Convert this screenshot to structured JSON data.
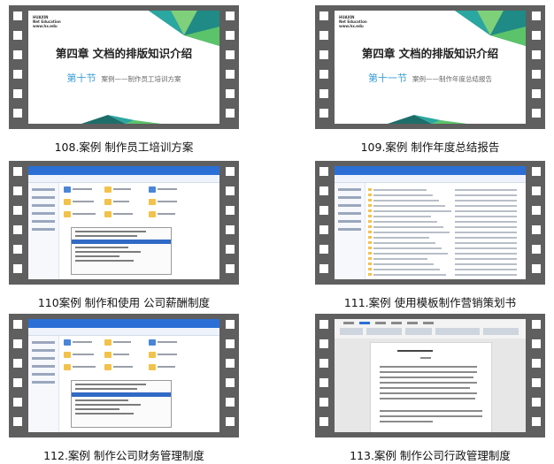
{
  "items": [
    {
      "caption": "108.案例 制作员工培训方案",
      "kind": "slide",
      "slide": {
        "logo": [
          "HUAXIN",
          "Net Education",
          "www.hx.edu"
        ],
        "title": "第四章  文档的排版知识介绍",
        "section": "第十节",
        "subtitle": "案例——制作员工培训方案"
      }
    },
    {
      "caption": "109.案例 制作年度总结报告",
      "kind": "slide",
      "slide": {
        "logo": [
          "HUAXIN",
          "Net Education",
          "www.hx.edu"
        ],
        "title": "第四章  文档的排版知识介绍",
        "section": "第十一节",
        "subtitle": "案例——制作年度总结报告"
      }
    },
    {
      "caption": "110案例 制作和使用 公司薪酬制度",
      "kind": "explorer"
    },
    {
      "caption": "111.案例 使用模板制作营销策划书",
      "kind": "filelist"
    },
    {
      "caption": "112.案例 制作公司财务管理制度",
      "kind": "explorer"
    },
    {
      "caption": "113.案例 制作公司行政管理制度",
      "kind": "document"
    }
  ],
  "colors": {
    "film": "#5f5f5f",
    "accent": "#3b9fd6",
    "window_title": "#2b6fd6"
  }
}
